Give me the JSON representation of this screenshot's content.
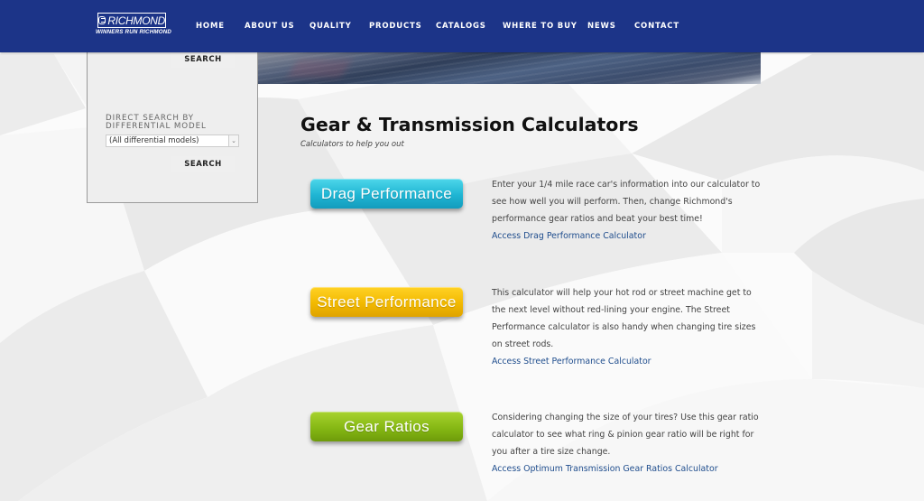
{
  "brand": {
    "name": "RICHMOND",
    "tagline": "WINNERS RUN RICHMOND",
    "nav_bg": "#1c3488"
  },
  "nav": [
    {
      "label": "HOME"
    },
    {
      "label": "ABOUT US"
    },
    {
      "label": "QUALITY"
    },
    {
      "label": "PRODUCTS"
    },
    {
      "label": "CATALOGS"
    },
    {
      "label": "WHERE TO BUY"
    },
    {
      "label": "NEWS"
    },
    {
      "label": "CONTACT"
    }
  ],
  "sidebar": {
    "search_button_top": "SEARCH",
    "direct_search_label": "DIRECT SEARCH BY DIFFERENTIAL MODEL",
    "model_select_value": "(All differential models)",
    "search_button_bottom": "SEARCH"
  },
  "main": {
    "title": "Gear & Transmission Calculators",
    "subtitle": "Calculators to help you out",
    "calculators": [
      {
        "button": "Drag Performance",
        "color": "#1fb5d3",
        "description": "Enter your 1/4 mile race car's information into our calculator to see how well you will perform. Then, change Richmond's performance gear ratios and beat your best time!",
        "link": "Access Drag Performance Calculator"
      },
      {
        "button": "Street Performance",
        "color": "#f2b900",
        "description": "This calculator will help your hot rod or street machine get to the next level without red-lining your engine. The Street Performance calculator is also handy when changing tire sizes on street rods.",
        "link": "Access Street Performance Calculator"
      },
      {
        "button": "Gear Ratios",
        "color": "#86b814",
        "description": "Considering changing the size of your tires? Use this gear ratio calculator to see what ring & pinion gear ratio will be right for you after a tire size change.",
        "link": "Access Optimum Transmission Gear Ratios Calculator"
      }
    ]
  }
}
